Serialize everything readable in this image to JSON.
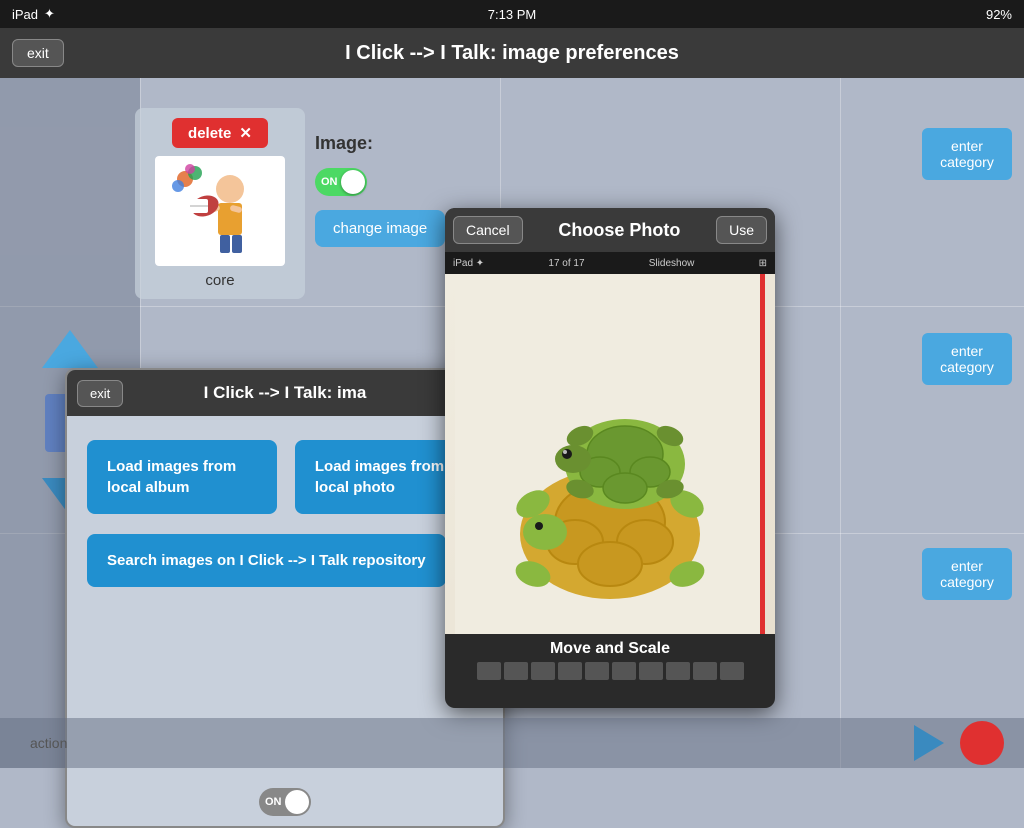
{
  "status_bar": {
    "left": "iPad",
    "time": "7:13 PM",
    "battery": "92%"
  },
  "title_bar": {
    "title": "I Click --> I Talk: image preferences",
    "exit_label": "exit"
  },
  "card": {
    "delete_label": "delete",
    "label": "core"
  },
  "image_controls": {
    "label": "Image:",
    "toggle_on": "ON",
    "change_image_label": "change image"
  },
  "enter_category_label": "enter category",
  "dialog_prefs": {
    "exit_label": "exit",
    "title": "I Click --> I Talk: ima",
    "btn1_label": "Load images from local album",
    "btn2_label": "Load images from local photo",
    "btn3_label": "Search images on I Click --> I Talk repository",
    "toggle_on": "ON"
  },
  "choose_photo": {
    "cancel_label": "Cancel",
    "title": "Choose Photo",
    "use_label": "Use",
    "sub_bar_left": "iPad ✦",
    "sub_bar_center": "17 of 17",
    "sub_bar_right": "Slideshow",
    "move_scale": "Move and Scale"
  },
  "action_bar": {
    "label": "action"
  }
}
